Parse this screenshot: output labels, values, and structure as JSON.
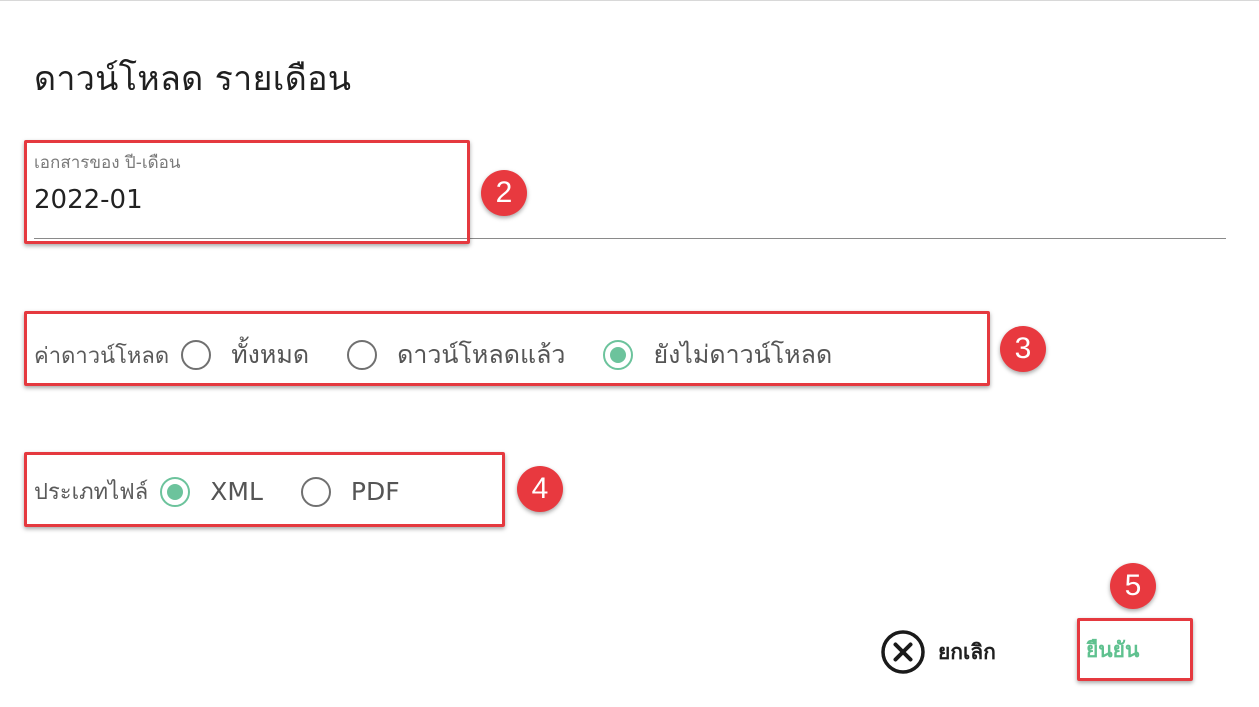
{
  "dialog": {
    "title": "ดาวน์โหลด รายเดือน",
    "period_field": {
      "label": "เอกสารของ ปี-เดือน",
      "value": "2022-01"
    },
    "download_status": {
      "label": "ค่าดาวน์โหลด",
      "options": [
        "ทั้งหมด",
        "ดาวน์โหลดแล้ว",
        "ยังไม่ดาวน์โหลด"
      ],
      "selected": "ยังไม่ดาวน์โหลด"
    },
    "file_type": {
      "label": "ประเภทไฟล์",
      "options": [
        "XML",
        "PDF"
      ],
      "selected": "XML"
    },
    "actions": {
      "cancel_label": "ยกเลิก",
      "cancel_icon": "close-circle-icon",
      "confirm_label": "ยืนยัน"
    }
  },
  "annotations": {
    "badges": [
      "2",
      "3",
      "4",
      "5"
    ],
    "highlight_color": "#e5393f"
  },
  "colors": {
    "accent_green": "#6cc39c",
    "badge_red": "#e8393f"
  }
}
